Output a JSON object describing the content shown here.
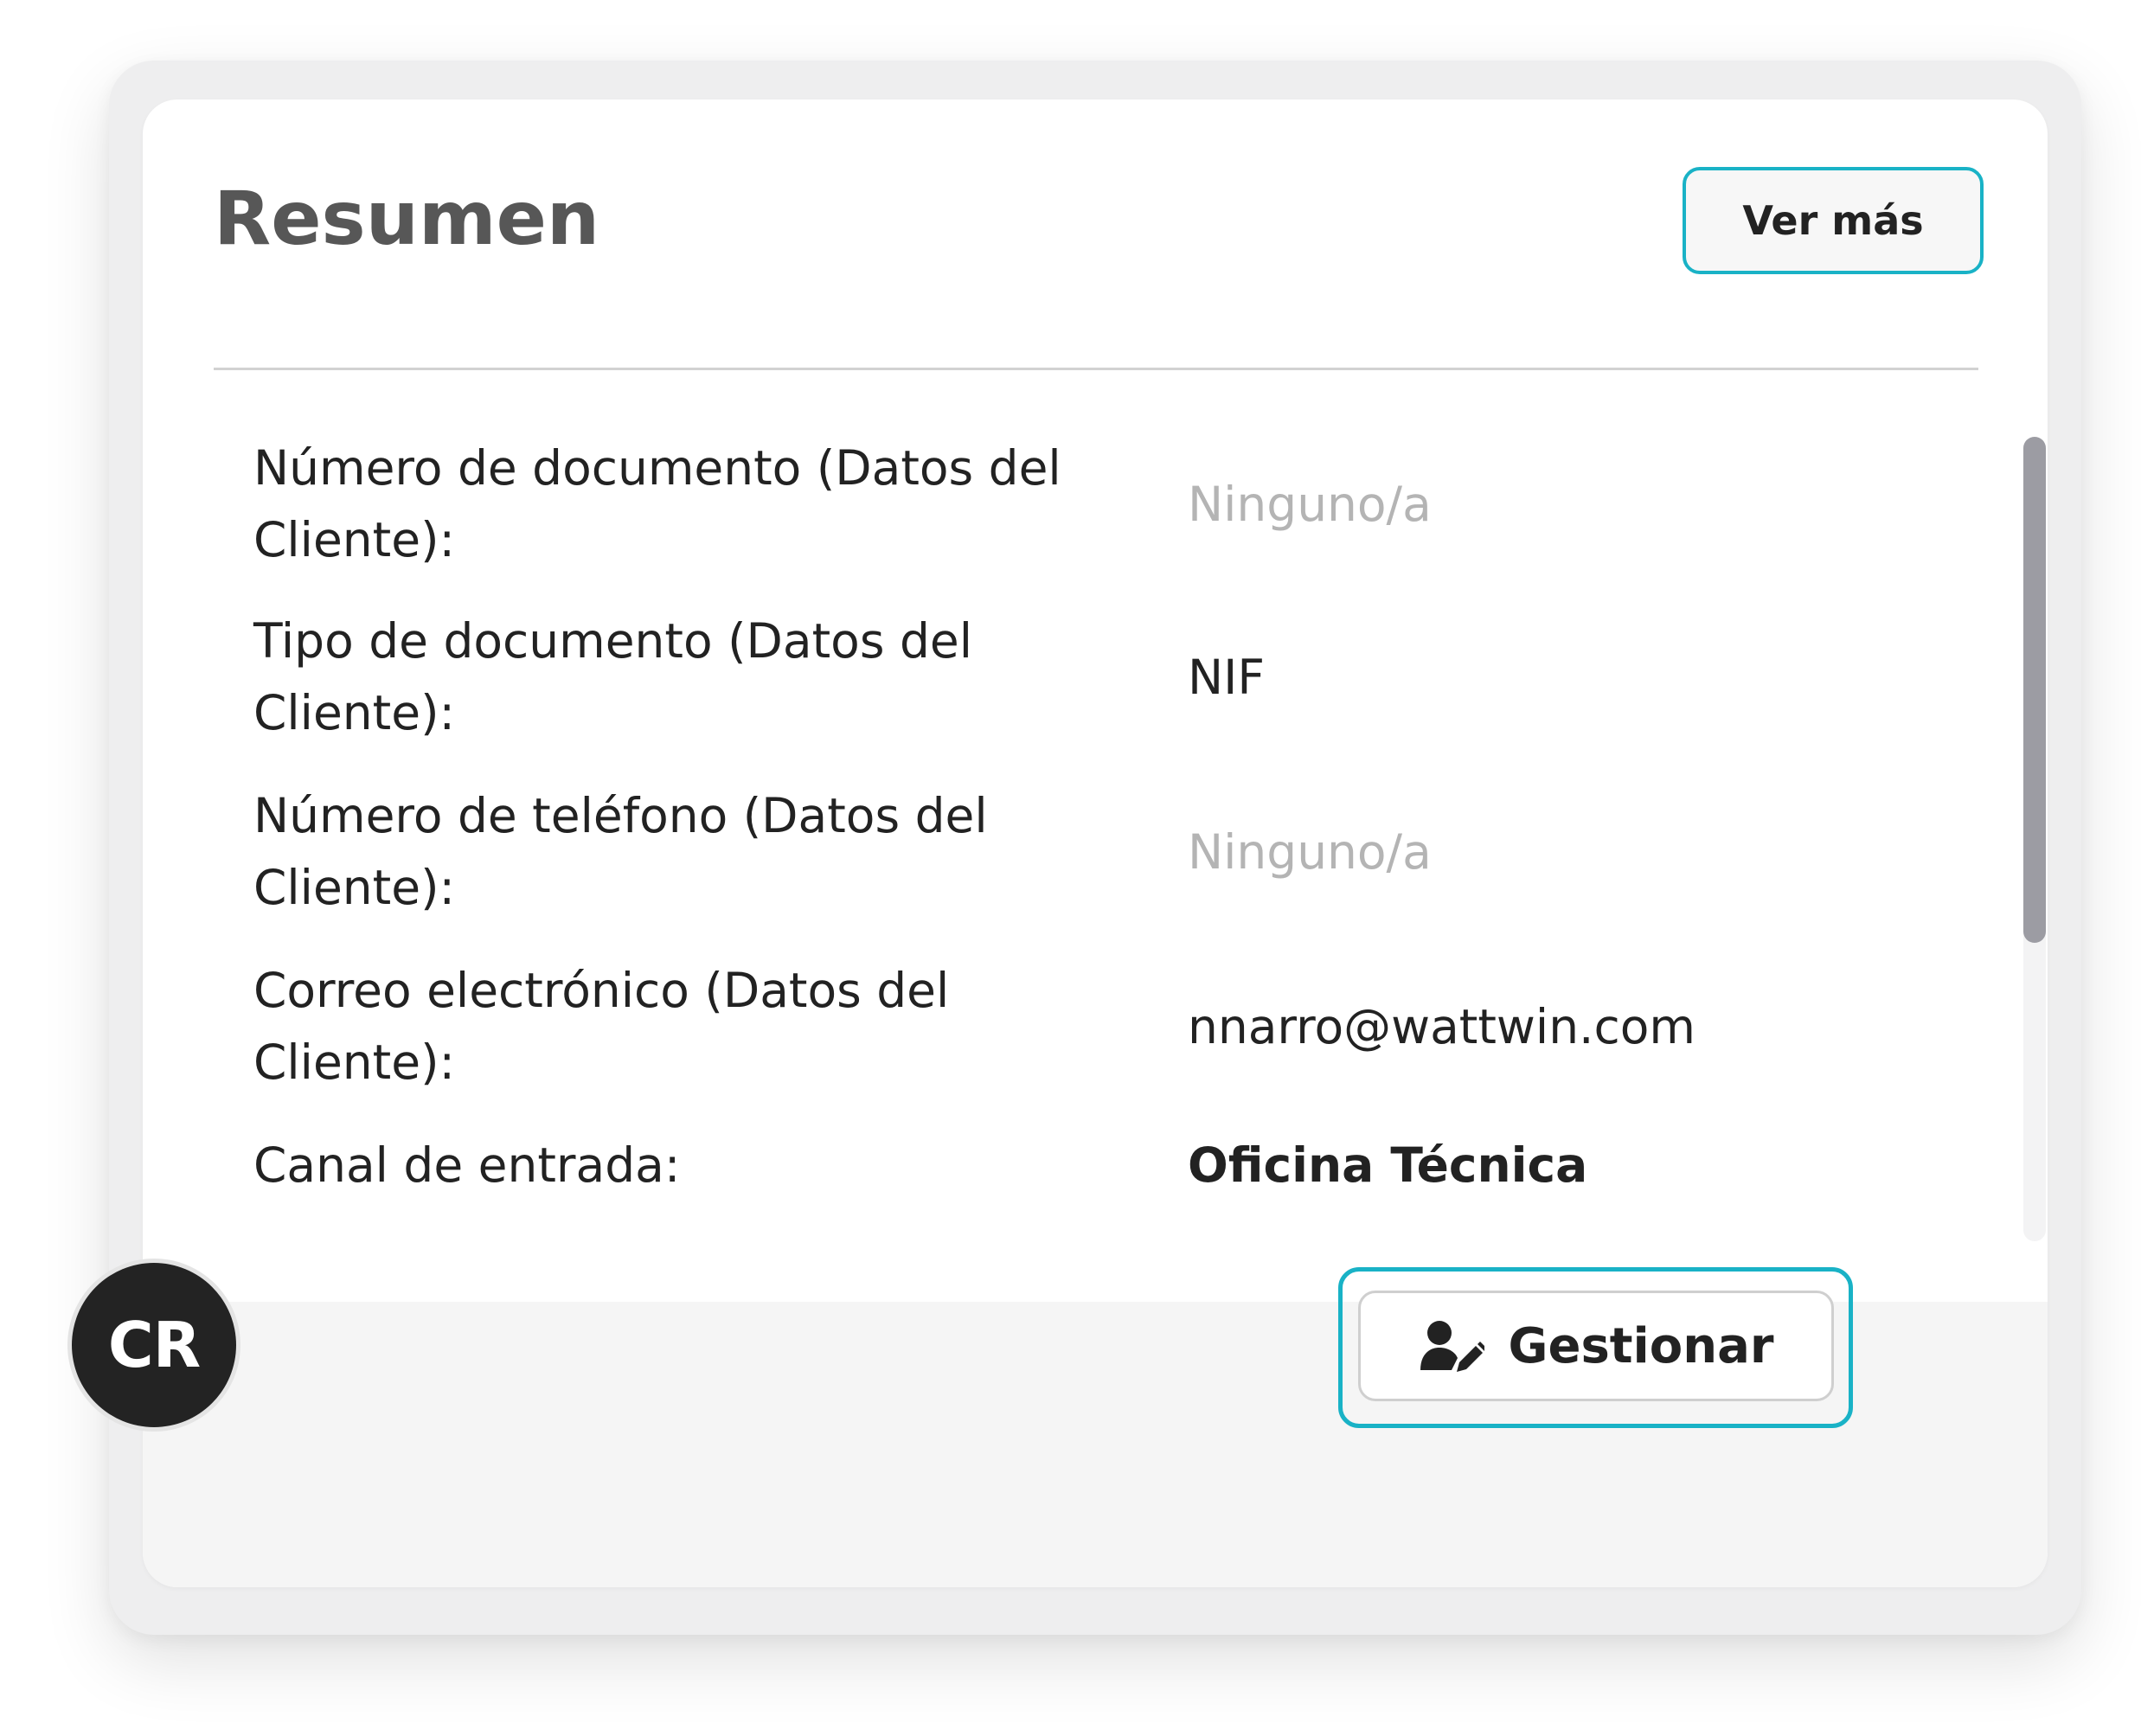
{
  "summary": {
    "title": "Resumen",
    "ver_mas_label": "Ver más"
  },
  "fields": [
    {
      "label": "Número de documento (Datos del Cliente):",
      "value": "Ninguno/a",
      "empty": true,
      "bold": false
    },
    {
      "label": "Tipo de documento (Datos del Cliente):",
      "value": "NIF",
      "empty": false,
      "bold": false
    },
    {
      "label": "Número de teléfono (Datos del Cliente):",
      "value": "Ninguno/a",
      "empty": true,
      "bold": false
    },
    {
      "label": "Correo electrónico (Datos del Cliente):",
      "value": "nnarro@wattwin.com",
      "empty": false,
      "bold": false
    },
    {
      "label": "Canal de entrada:",
      "value": "Oficina Técnica",
      "empty": false,
      "bold": true
    }
  ],
  "footer": {
    "avatar_initials": "CR",
    "gestionar_label": "Gestionar",
    "gestionar_icon": "user-edit-icon"
  },
  "colors": {
    "focus_ring": "#19b2c6",
    "placeholder_text": "#b4b4b4",
    "text": "#222222",
    "avatar_bg": "#232323"
  }
}
